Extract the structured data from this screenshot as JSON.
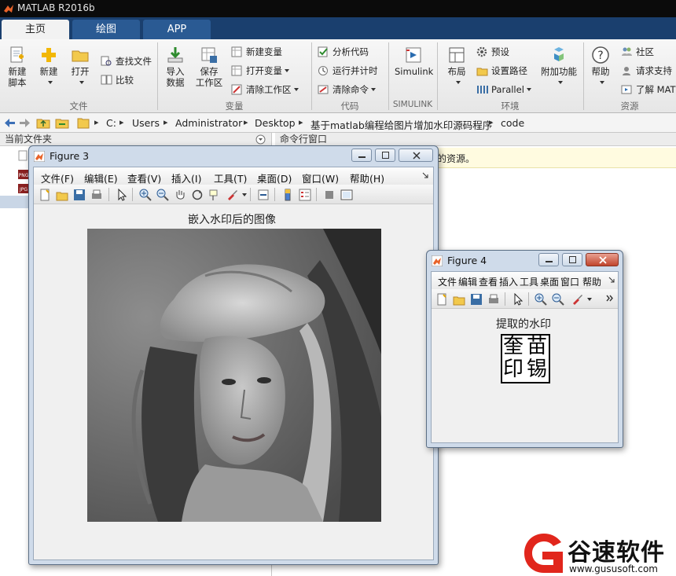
{
  "app": {
    "title": "MATLAB R2016b"
  },
  "ribbon": {
    "tabs": [
      "主页",
      "绘图",
      "APP"
    ],
    "file_group": {
      "new_script": "新建\n脚本",
      "new": "新建",
      "open": "打开",
      "find_files": "查找文件",
      "compare": "比较",
      "label": "文件"
    },
    "variable_group": {
      "import": "导入\n数据",
      "save_ws": "保存\n工作区",
      "new_var": "新建变量",
      "open_var": "打开变量",
      "clear_ws": "清除工作区",
      "label": "变量"
    },
    "code_group": {
      "analyze": "分析代码",
      "run_time": "运行并计时",
      "clear_cmd": "清除命令",
      "label": "代码"
    },
    "simulink_group": {
      "simulink": "Simulink",
      "label": "SIMULINK"
    },
    "env_group": {
      "layout": "布局",
      "prefs": "预设",
      "set_path": "设置路径",
      "parallel": "Parallel",
      "addons": "附加功能",
      "label": "环境"
    },
    "res_group": {
      "help": "帮助",
      "community": "社区",
      "support": "请求支持",
      "learn": "了解 MAT",
      "label": "资源"
    }
  },
  "address": {
    "parts": [
      "C:",
      "Users",
      "Administrator",
      "Desktop",
      "基于matlab编程给图片增加水印源码程序",
      "code"
    ]
  },
  "panels": {
    "left_header": "当前文件夹",
    "right_header": "命令行窗口",
    "info_text": "的资源。"
  },
  "figure3": {
    "title": "Figure 3",
    "menus": [
      "文件(F)",
      "编辑(E)",
      "查看(V)",
      "插入(I)",
      "工具(T)",
      "桌面(D)",
      "窗口(W)",
      "帮助(H)"
    ],
    "axes_title": "嵌入水印后的图像"
  },
  "figure4": {
    "title": "Figure 4",
    "menus": [
      "文件",
      "编辑",
      "查看",
      "插入",
      "工具",
      "桌面",
      "窗口",
      "帮助"
    ],
    "axes_title": "提取的水印",
    "watermark_chars": [
      "奎",
      "苗",
      "印",
      "锡"
    ]
  },
  "watermark_logo": {
    "brand": "谷速软件",
    "url": "www.gususoft.com"
  },
  "colors": {
    "ribbon_tab_bar": "#1a3f6e",
    "window_frame": "#cfdbea",
    "logo_red": "#e1261c"
  }
}
